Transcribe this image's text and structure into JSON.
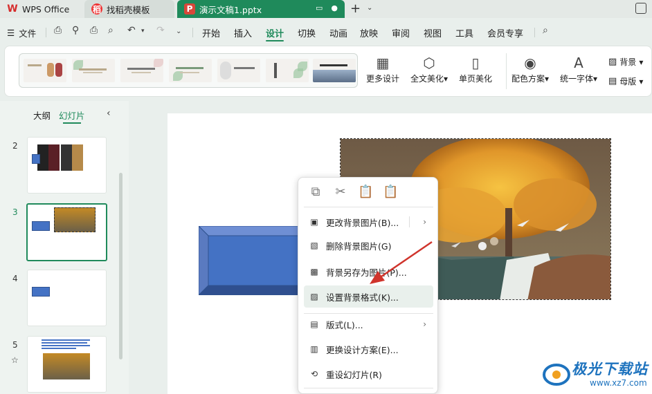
{
  "tabs": [
    {
      "label": "WPS Office",
      "icon": "wps-logo-icon"
    },
    {
      "label": "找稻壳模板",
      "icon": "docer-icon"
    },
    {
      "label": "演示文稿1.pptx",
      "icon": "ppt-file-icon"
    }
  ],
  "menu": {
    "file_label": "文件",
    "items": [
      "开始",
      "插入",
      "设计",
      "切换",
      "动画",
      "放映",
      "审阅",
      "视图",
      "工具",
      "会员专享"
    ],
    "active": "设计"
  },
  "ribbon": {
    "more_design": "更多设计",
    "full_beautify": "全文美化",
    "page_beautify": "单页美化",
    "color_scheme": "配色方案",
    "unify_font": "统一字体",
    "background": "背景",
    "master": "母版"
  },
  "left_panel": {
    "tab_outline": "大纲",
    "tab_slides": "幻灯片",
    "slide_numbers": [
      "2",
      "3",
      "4",
      "5"
    ],
    "active_slide": "3"
  },
  "context_menu": {
    "items": [
      {
        "label": "更改背景图片(B)...",
        "icon": "change-bg-icon",
        "submenu": true
      },
      {
        "label": "删除背景图片(G)",
        "icon": "delete-bg-icon"
      },
      {
        "label": "背景另存为图片(P)...",
        "icon": "save-bg-icon"
      },
      {
        "label": "设置背景格式(K)...",
        "icon": "bg-format-icon",
        "highlighted": true
      },
      {
        "label": "版式(L)...",
        "icon": "layout-icon",
        "submenu": true
      },
      {
        "label": "更换设计方案(E)...",
        "icon": "design-scheme-icon"
      },
      {
        "label": "重设幻灯片(R)",
        "icon": "reset-slide-icon"
      }
    ]
  },
  "watermark": {
    "text": "极光下载站",
    "url": "www.xz7.com"
  },
  "colors": {
    "accent": "#1f8a5b",
    "shape_blue": "#4472c4"
  }
}
